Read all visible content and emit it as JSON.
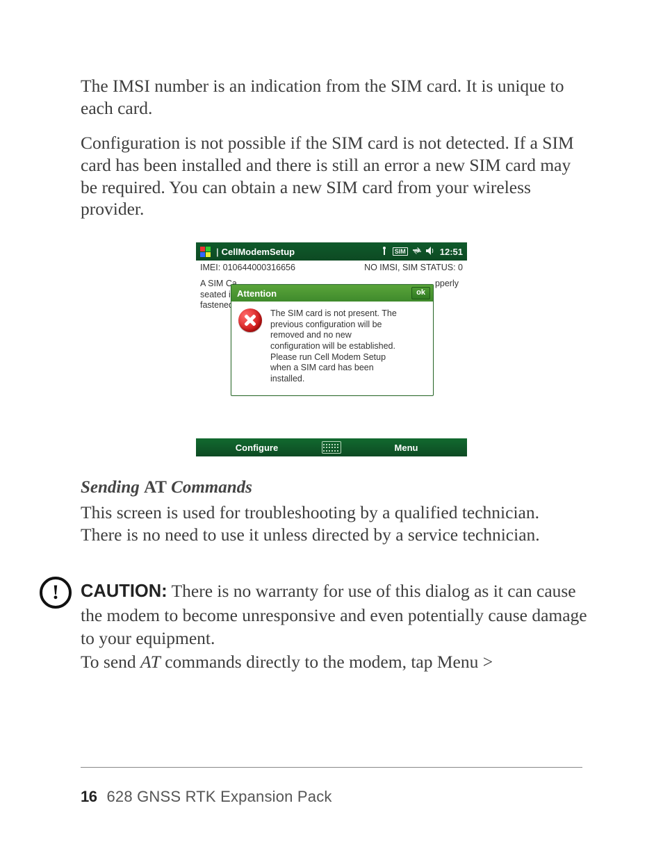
{
  "para1": "The IMSI number is an indication from the SIM card. It is unique to each card.",
  "para2": "Configuration is not possible if the SIM card is not detected. If a SIM card has been installed and there is still an error a new SIM card may be required. You can obtain a new SIM card from your wireless provider.",
  "screenshot": {
    "titlebar": {
      "app": "CellModemSetup",
      "clock": "12:51"
    },
    "info": {
      "imei_label": "IMEI: 010644000316656",
      "status_label": "NO IMSI, SIM STATUS: 0"
    },
    "bg_left_lines": "A SIM Ca\nseated in\nfastened",
    "bg_right": "pperly",
    "dialog": {
      "title": "Attention",
      "ok": "ok",
      "message": "The SIM card is not present.  The previous configuration will be removed and no new configuration will be established.  Please run Cell Modem Setup when a SIM card has been installed."
    },
    "softkeys": {
      "left": "Configure",
      "right": "Menu"
    }
  },
  "section": {
    "w1": "Sending",
    "w2": "AT",
    "w3": "Commands"
  },
  "para3": "This screen is used for troubleshooting by a qualified technician. There is no need to use it unless directed by a service technician.",
  "caution": {
    "label": "CAUTION:",
    "text1": "  There is no warranty for use of this dialog as it can cause the modem to become unresponsive and even potentially cause damage to your equipment.",
    "line2a": "To send ",
    "line2_it": "AT",
    "line2b": " commands directly to the modem, tap Menu >"
  },
  "footer": {
    "page": "16",
    "title": "628 GNSS RTK Expansion Pack"
  }
}
